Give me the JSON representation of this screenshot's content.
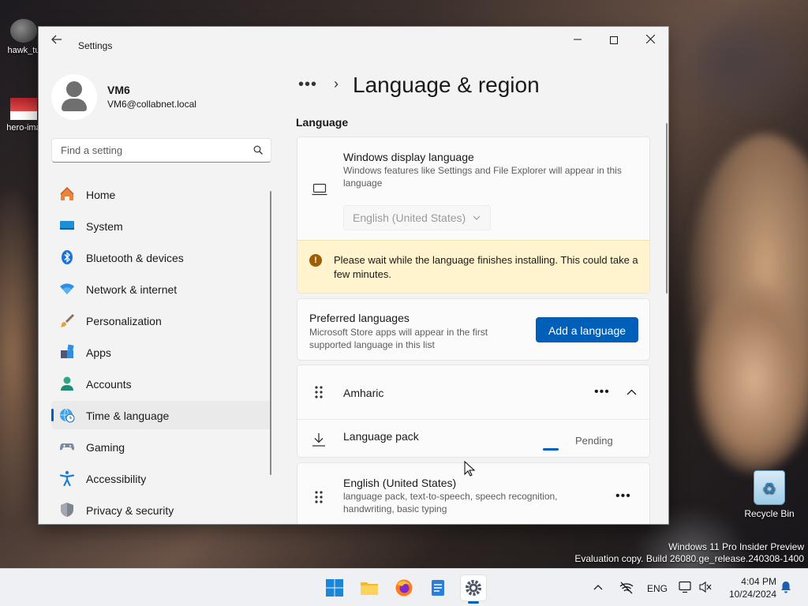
{
  "desktop": {
    "icons": [
      {
        "label": "hawk_tu"
      },
      {
        "label": "hero-ima"
      },
      {
        "label": "Recycle Bin"
      }
    ],
    "watermark": {
      "line1": "Windows 11 Pro Insider Preview",
      "line2": "Evaluation copy. Build 26080.ge_release.240308-1400"
    }
  },
  "window": {
    "app_title": "Settings",
    "back_icon": "arrow-left",
    "controls": {
      "minimize": "—",
      "close": "✕"
    }
  },
  "profile": {
    "name": "VM6",
    "email": "VM6@collabnet.local"
  },
  "search": {
    "placeholder": "Find a setting"
  },
  "sidebar": {
    "items": [
      {
        "label": "Home",
        "icon": "home-icon"
      },
      {
        "label": "System",
        "icon": "system-icon"
      },
      {
        "label": "Bluetooth & devices",
        "icon": "bluetooth-icon"
      },
      {
        "label": "Network & internet",
        "icon": "wifi-icon"
      },
      {
        "label": "Personalization",
        "icon": "brush-icon"
      },
      {
        "label": "Apps",
        "icon": "apps-icon"
      },
      {
        "label": "Accounts",
        "icon": "accounts-icon"
      },
      {
        "label": "Time & language",
        "icon": "globe-clock-icon",
        "active": true
      },
      {
        "label": "Gaming",
        "icon": "gamepad-icon"
      },
      {
        "label": "Accessibility",
        "icon": "accessibility-icon"
      },
      {
        "label": "Privacy & security",
        "icon": "shield-icon"
      }
    ]
  },
  "breadcrumb": {
    "dots": "•••",
    "separator": "›"
  },
  "page": {
    "title": "Language & region",
    "section_language": "Language"
  },
  "display_language": {
    "title": "Windows display language",
    "description": "Windows features like Settings and File Explorer will appear in this language",
    "selected": "English (United States)",
    "warning": "Please wait while the language finishes installing. This could take a few minutes."
  },
  "preferred": {
    "title": "Preferred languages",
    "description": "Microsoft Store apps will appear in the first supported language in this list",
    "add_button": "Add a language"
  },
  "languages": [
    {
      "name": "Amharic",
      "more": "•••",
      "sub_item": {
        "label": "Language pack",
        "status": "Pending"
      }
    },
    {
      "name": "English (United States)",
      "features": "language pack, text-to-speech, speech recognition, handwriting, basic typing",
      "more": "•••"
    }
  ],
  "taskbar": {
    "apps": [
      "start-icon",
      "file-explorer-icon",
      "firefox-icon",
      "notepad-icon",
      "settings-icon"
    ],
    "tray": {
      "chevron": "⌃",
      "language": "ENG",
      "time": "4:04 PM",
      "date": "10/24/2024"
    }
  },
  "colors": {
    "accent": "#005fb8",
    "warning_bg": "#fff4ce",
    "window_bg": "#f3f3f3"
  }
}
